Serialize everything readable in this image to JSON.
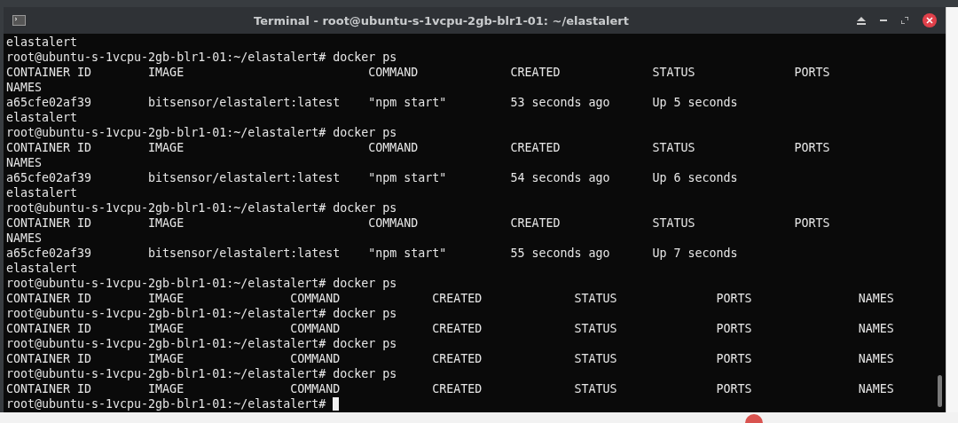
{
  "window": {
    "title": "Terminal - root@ubuntu-s-1vcpu-2gb-blr1-01: ~/elastalert"
  },
  "terminal": {
    "lines": [
      "elastalert",
      "root@ubuntu-s-1vcpu-2gb-blr1-01:~/elastalert# docker ps",
      "CONTAINER ID        IMAGE                          COMMAND             CREATED             STATUS              PORTS",
      "NAMES",
      "a65cfe02af39        bitsensor/elastalert:latest    \"npm start\"         53 seconds ago      Up 5 seconds",
      "elastalert",
      "root@ubuntu-s-1vcpu-2gb-blr1-01:~/elastalert# docker ps",
      "CONTAINER ID        IMAGE                          COMMAND             CREATED             STATUS              PORTS",
      "NAMES",
      "a65cfe02af39        bitsensor/elastalert:latest    \"npm start\"         54 seconds ago      Up 6 seconds",
      "elastalert",
      "root@ubuntu-s-1vcpu-2gb-blr1-01:~/elastalert# docker ps",
      "CONTAINER ID        IMAGE                          COMMAND             CREATED             STATUS              PORTS",
      "NAMES",
      "a65cfe02af39        bitsensor/elastalert:latest    \"npm start\"         55 seconds ago      Up 7 seconds",
      "elastalert",
      "root@ubuntu-s-1vcpu-2gb-blr1-01:~/elastalert# docker ps",
      "CONTAINER ID        IMAGE               COMMAND             CREATED             STATUS              PORTS               NAMES",
      "root@ubuntu-s-1vcpu-2gb-blr1-01:~/elastalert# docker ps",
      "CONTAINER ID        IMAGE               COMMAND             CREATED             STATUS              PORTS               NAMES",
      "root@ubuntu-s-1vcpu-2gb-blr1-01:~/elastalert# docker ps",
      "CONTAINER ID        IMAGE               COMMAND             CREATED             STATUS              PORTS               NAMES",
      "root@ubuntu-s-1vcpu-2gb-blr1-01:~/elastalert# docker ps",
      "CONTAINER ID        IMAGE               COMMAND             CREATED             STATUS              PORTS               NAMES",
      "root@ubuntu-s-1vcpu-2gb-blr1-01:~/elastalert# "
    ],
    "cursor": true
  }
}
